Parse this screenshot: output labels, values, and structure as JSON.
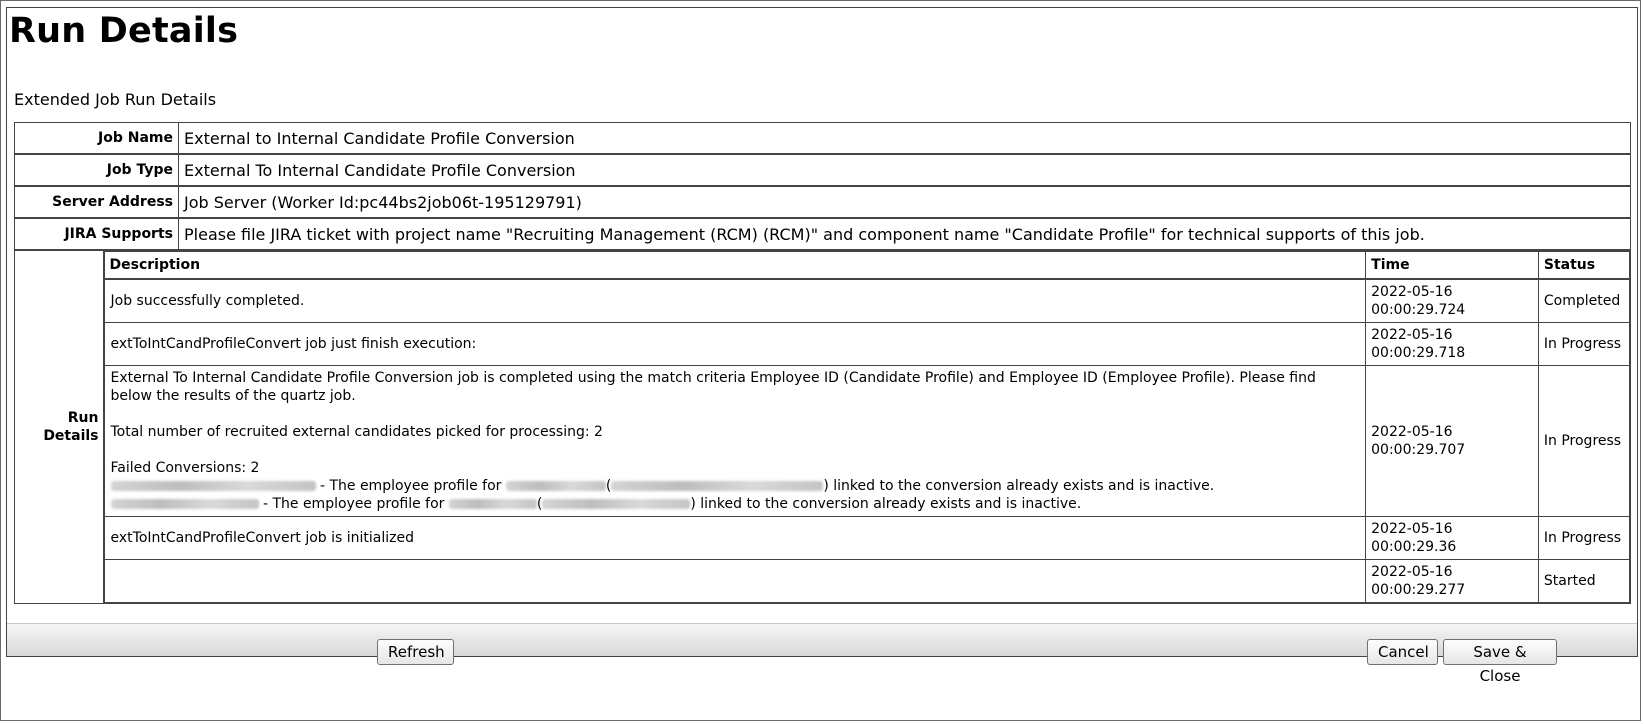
{
  "page": {
    "title": "Run Details",
    "subtitle": "Extended Job Run Details"
  },
  "details": {
    "job_name_label": "Job Name",
    "job_name": "External to Internal Candidate Profile Conversion",
    "job_type_label": "Job Type",
    "job_type": "External To Internal Candidate Profile Conversion",
    "server_address_label": "Server Address",
    "server_address": "Job Server (Worker Id:pc44bs2job06t-195129791)",
    "jira_label": "JIRA Supports",
    "jira": "Please file JIRA ticket with project name \"Recruiting Management (RCM) (RCM)\" and component name \"Candidate Profile\" for technical supports of this job.",
    "run_details_label": "Run Details"
  },
  "runs": {
    "headers": {
      "description": "Description",
      "time": "Time",
      "status": "Status"
    },
    "rows": [
      {
        "description": "Job successfully completed.",
        "date": "2022-05-16",
        "time": "00:00:29.724",
        "status": "Completed"
      },
      {
        "description": "extToIntCandProfileConvert job just finish execution:",
        "date": "2022-05-16",
        "time": "00:00:29.718",
        "status": "In Progress"
      },
      {
        "description_lines": {
          "line1": "External To Internal Candidate Profile Conversion job is completed using the match criteria Employee ID (Candidate Profile) and Employee ID (Employee Profile). Please find below the results of the quartz job.",
          "line2": "Total number of recruited external candidates picked for processing: 2",
          "line3": "Failed Conversions: 2",
          "failure1_mid": " - The employee profile for ",
          "failure1_end": ") linked to the conversion already exists and is inactive.",
          "failure2_mid": " - The employee profile for ",
          "failure2_end": ") linked to the conversion already exists and is inactive."
        },
        "date": "2022-05-16",
        "time": "00:00:29.707",
        "status": "In Progress"
      },
      {
        "description": "extToIntCandProfileConvert job is initialized",
        "date": "2022-05-16",
        "time": "00:00:29.36",
        "status": "In Progress"
      },
      {
        "description": "",
        "date": "2022-05-16",
        "time": "00:00:29.277",
        "status": "Started"
      }
    ]
  },
  "buttons": {
    "refresh": "Refresh",
    "cancel": "Cancel",
    "save_close": "Save & Close"
  }
}
